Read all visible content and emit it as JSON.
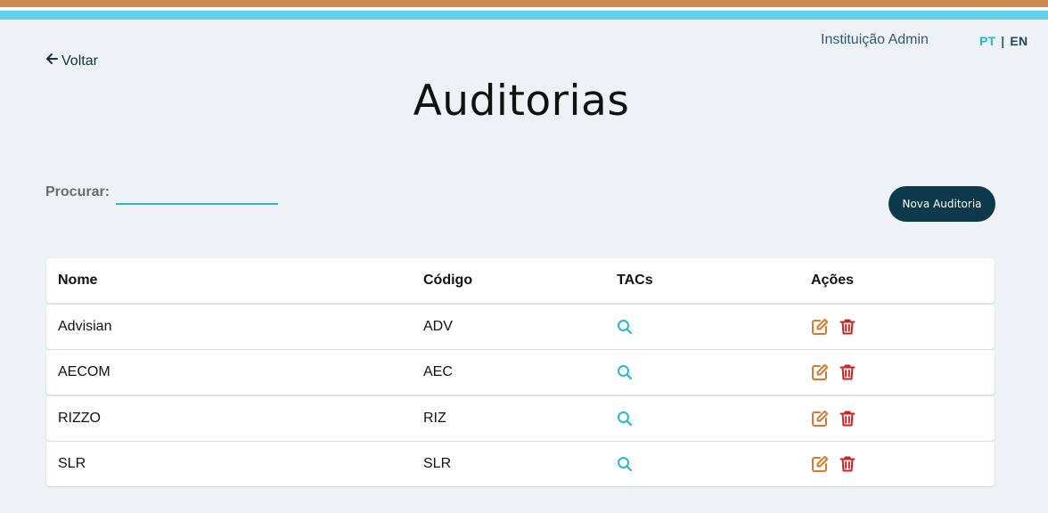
{
  "header": {
    "user_name": "Instituição Admin",
    "lang_pt": "PT",
    "lang_sep": "|",
    "lang_en": "EN",
    "accent_color": "#2bb5d1",
    "brand_dark": "#0c3a4a"
  },
  "nav": {
    "back_label": "Voltar"
  },
  "page": {
    "title": "Auditorias"
  },
  "search": {
    "label": "Procurar:",
    "value": "",
    "placeholder": ""
  },
  "actions": {
    "new_label": "Nova Auditoria"
  },
  "table": {
    "headers": {
      "nome": "Nome",
      "codigo": "Código",
      "tacs": "TACs",
      "acoes": "Ações"
    },
    "rows": [
      {
        "nome": "Advisian",
        "codigo": "ADV"
      },
      {
        "nome": "AECOM",
        "codigo": "AEC"
      },
      {
        "nome": "RIZZO",
        "codigo": "RIZ"
      },
      {
        "nome": "SLR",
        "codigo": "SLR"
      }
    ],
    "icons": {
      "tac": "search-icon",
      "edit": "edit-icon",
      "delete": "trash-icon"
    },
    "icon_colors": {
      "tac": "#2bb5d1",
      "edit": "#d9782f",
      "delete": "#cc2222"
    }
  }
}
